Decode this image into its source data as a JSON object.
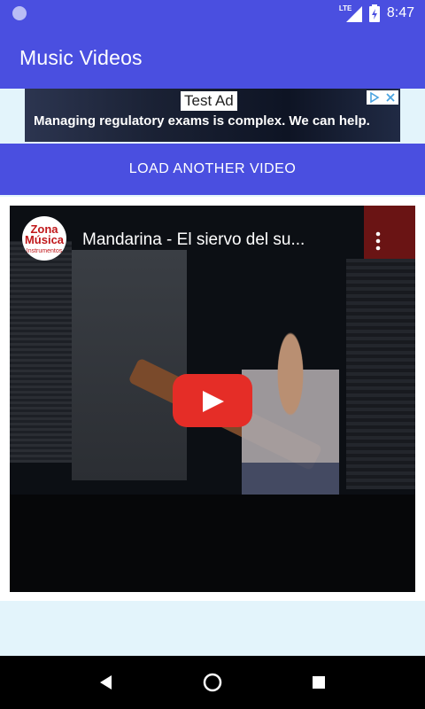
{
  "status_bar": {
    "network": "LTE",
    "time": "8:47",
    "icons": [
      "notification-dot-icon",
      "signal-icon",
      "battery-icon"
    ]
  },
  "app_bar": {
    "title": "Music Videos"
  },
  "ad": {
    "label": "Test Ad",
    "text": "Managing regulatory exams is complex. We can help.",
    "choices_icons": [
      "ad-choices-icon",
      "close-icon"
    ]
  },
  "load_button": {
    "label": "LOAD ANOTHER VIDEO"
  },
  "video": {
    "title": "Mandarina - El siervo del su...",
    "channel_avatar_text": "Zona\nMúsica",
    "channel_avatar_sub": "Instrumentos",
    "icons": [
      "play-icon",
      "more-vert-icon"
    ]
  },
  "nav_bar": {
    "icons": [
      "back-icon",
      "home-icon",
      "recents-icon"
    ]
  },
  "colors": {
    "primary": "#4a4fe0",
    "background": "#e3f4fb",
    "play_red": "#e52d27"
  }
}
